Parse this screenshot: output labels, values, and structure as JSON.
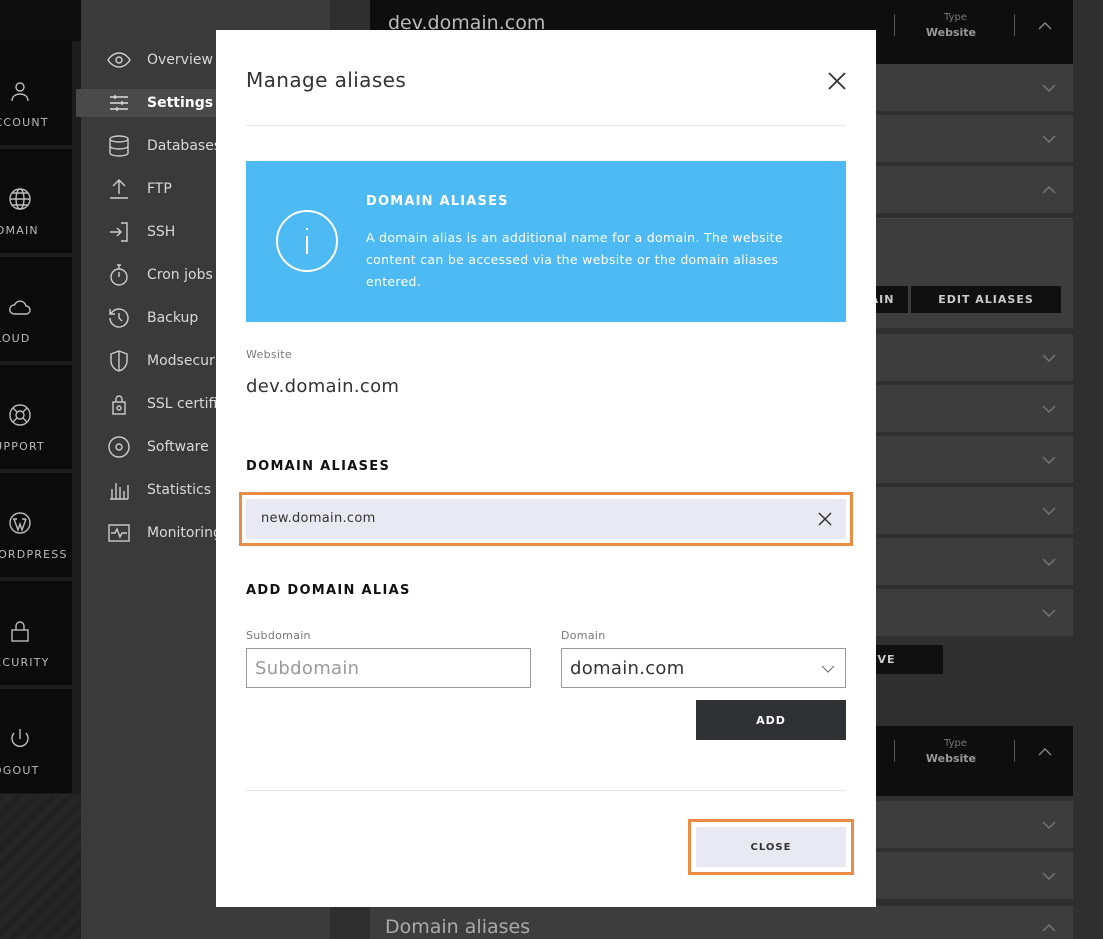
{
  "leftnav": {
    "items": [
      {
        "label": "ACCOUNT",
        "icon": "user-icon"
      },
      {
        "label": "DOMAIN",
        "icon": "globe-icon"
      },
      {
        "label": "CLOUD",
        "icon": "cloud-icon"
      },
      {
        "label": "SUPPORT",
        "icon": "lifebuoy-icon"
      },
      {
        "label": "WORDPRESS",
        "icon": "wordpress-icon"
      },
      {
        "label": "SECURITY",
        "icon": "lock-icon"
      },
      {
        "label": "LOGOUT",
        "icon": "power-icon"
      }
    ]
  },
  "submenu": {
    "items": [
      {
        "label": "Overview",
        "icon": "eye-icon"
      },
      {
        "label": "Settings",
        "icon": "sliders-icon",
        "active": true
      },
      {
        "label": "Databases",
        "icon": "database-icon"
      },
      {
        "label": "FTP",
        "icon": "upload-icon"
      },
      {
        "label": "SSH",
        "icon": "login-icon"
      },
      {
        "label": "Cron jobs",
        "icon": "stopwatch-icon"
      },
      {
        "label": "Backup",
        "icon": "history-icon"
      },
      {
        "label": "Modsecuri",
        "icon": "shield-icon"
      },
      {
        "label": "SSL certifi",
        "icon": "certificate-icon"
      },
      {
        "label": "Software",
        "icon": "disc-icon"
      },
      {
        "label": "Statistics",
        "icon": "bar-chart-icon"
      },
      {
        "label": "Monitoring",
        "icon": "pulse-icon"
      }
    ]
  },
  "background": {
    "header_title": "dev.domain.com",
    "type_key": "Type",
    "type_value": "Website",
    "edit_aliases_label": "EDIT ALIASES",
    "partial_btn_label": "AIN",
    "partial_save_label": "VE",
    "domain_aliases_title": "Domain aliases"
  },
  "modal": {
    "title": "Manage aliases",
    "info": {
      "heading": "DOMAIN ALIASES",
      "text": "A domain alias is an additional name for a domain. The website content can be accessed via the website or the domain aliases entered."
    },
    "website_label": "Website",
    "website_value": "dev.domain.com",
    "aliases_heading": "DOMAIN ALIASES",
    "aliases": [
      "new.domain.com"
    ],
    "add_heading": "ADD DOMAIN ALIAS",
    "subdomain_label": "Subdomain",
    "subdomain_placeholder": "Subdomain",
    "subdomain_value": "",
    "domain_label": "Domain",
    "domain_value": "domain.com",
    "add_button": "ADD",
    "close_button": "CLOSE"
  },
  "colors": {
    "info_blue": "#4dbaf3",
    "highlight_orange": "#ea8c43",
    "add_button_bg": "#303134",
    "alias_bg": "#e9e9f3"
  }
}
